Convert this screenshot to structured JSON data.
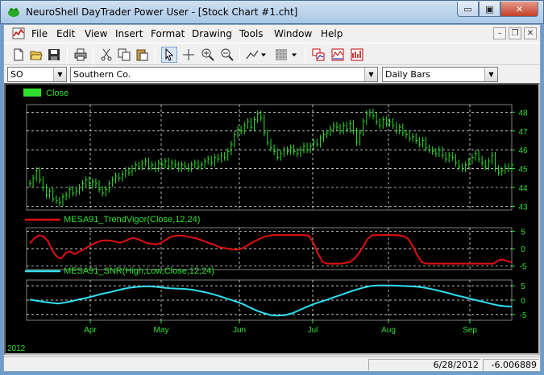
{
  "window": {
    "title": "NeuroShell DayTrader Power User - [Stock Chart #1.cht]",
    "min_glyph": "▭",
    "max_glyph": "▣",
    "close_glyph": "✕"
  },
  "menu": {
    "items": [
      "File",
      "Edit",
      "View",
      "Insert",
      "Format",
      "Drawing",
      "Tools",
      "Window",
      "Help"
    ],
    "mdi_min": "–",
    "mdi_restore": "❐",
    "mdi_close": "✕"
  },
  "toolbar": {
    "icons": [
      "new-document-icon",
      "open-folder-icon",
      "save-icon",
      "print-icon",
      "cut-icon",
      "copy-icon",
      "paste-icon",
      "pointer-icon",
      "crosshair-icon",
      "zoom-in-icon",
      "zoom-out-icon",
      "line-tool-icon",
      "fill-pattern-icon",
      "chart-window-icon",
      "indicator-icon",
      "bar-chart-icon"
    ]
  },
  "selectors": {
    "symbol": "SO",
    "company": "Southern Co.",
    "period": "Daily Bars"
  },
  "chart": {
    "colors": {
      "price": "#2fe02f",
      "trendvigor": "#e01010",
      "snr": "#30e0f0",
      "grid": "#ffffff",
      "axis_text": "#2fe02f",
      "background": "#000000"
    },
    "year_label": "2012"
  },
  "chart_data": [
    {
      "type": "bar",
      "legend": "Close",
      "series": [
        {
          "name": "Close",
          "values": [
            44.2,
            44.5,
            44.9,
            44.4,
            44.0,
            43.6,
            43.8,
            43.4,
            43.3,
            43.2,
            43.5,
            43.6,
            43.9,
            43.7,
            43.8,
            44.0,
            44.2,
            44.4,
            44.1,
            44.3,
            44.2,
            43.9,
            43.7,
            43.9,
            44.2,
            44.4,
            44.6,
            44.5,
            44.7,
            44.9,
            44.8,
            45.0,
            45.2,
            45.1,
            45.3,
            45.4,
            45.1,
            45.2,
            45.0,
            45.3,
            45.2,
            45.4,
            45.1,
            45.3,
            45.2,
            45.0,
            45.2,
            45.1,
            45.0,
            45.2,
            45.3,
            45.1,
            45.2,
            45.4,
            45.5,
            45.3,
            45.6,
            45.5,
            45.7,
            45.6,
            45.9,
            46.3,
            46.8,
            47.1,
            47.0,
            47.3,
            47.5,
            47.2,
            47.6,
            47.9,
            47.7,
            46.9,
            46.4,
            46.1,
            45.9,
            45.6,
            45.8,
            46.0,
            45.9,
            46.1,
            45.9,
            45.8,
            46.0,
            46.2,
            46.0,
            46.2,
            46.4,
            46.3,
            46.6,
            46.8,
            46.9,
            47.1,
            47.3,
            47.2,
            47.0,
            47.3,
            47.1,
            47.4,
            47.0,
            46.4,
            46.9,
            47.5,
            47.9,
            48.0,
            47.8,
            47.5,
            47.3,
            47.6,
            47.4,
            47.5,
            47.3,
            47.0,
            47.2,
            46.9,
            46.8,
            46.6,
            46.7,
            46.5,
            46.3,
            46.5,
            46.1,
            46.0,
            45.9,
            45.8,
            46.0,
            45.7,
            45.5,
            45.7,
            45.6,
            45.3,
            45.1,
            45.0,
            45.2,
            45.4,
            45.6,
            45.8,
            45.5,
            45.3,
            45.1,
            45.4,
            45.7,
            45.0,
            44.8,
            44.9,
            45.1,
            45.0,
            45.2
          ]
        }
      ],
      "yticks": [
        43,
        44,
        45,
        46,
        47,
        48
      ],
      "ylim": [
        42.8,
        48.4
      ]
    },
    {
      "type": "line",
      "legend": "MESA91_TrendVigor(Close,12,24)",
      "series": [
        {
          "name": "MESA91_TrendVigor(Close,12,24)",
          "values": [
            1.5,
            3.0,
            3.8,
            3.5,
            2.2,
            -0.5,
            -2.3,
            -2.8,
            -1.2,
            -0.8,
            -1.6,
            -0.8,
            -0.2,
            0.6,
            1.3,
            1.9,
            2.3,
            2.4,
            2.3,
            2.0,
            1.7,
            2.1,
            2.7,
            3.1,
            2.7,
            2.2,
            1.6,
            1.4,
            1.2,
            1.6,
            2.4,
            3.2,
            3.6,
            3.8,
            3.7,
            3.5,
            3.2,
            2.9,
            2.5,
            2.0,
            1.5,
            1.1,
            0.5,
            0.2,
            0.0,
            -0.2,
            -0.3,
            0.0,
            0.7,
            1.5,
            2.2,
            2.8,
            3.4,
            3.7,
            3.9,
            3.9,
            3.9,
            3.9,
            3.9,
            3.9,
            3.9,
            3.9,
            3.7,
            1.5,
            -1.5,
            -3.8,
            -4.3,
            -4.3,
            -4.3,
            -4.3,
            -4.1,
            -3.9,
            -2.9,
            -1.4,
            0.6,
            2.8,
            3.8,
            3.9,
            3.9,
            3.9,
            3.9,
            3.9,
            3.8,
            3.6,
            2.8,
            0.8,
            -1.8,
            -3.8,
            -4.3,
            -4.3,
            -4.3,
            -4.3,
            -4.3,
            -4.3,
            -4.3,
            -4.3,
            -4.3,
            -4.3,
            -4.3,
            -4.3,
            -4.3,
            -4.3,
            -4.3,
            -4.3,
            -3.4,
            -3.1,
            -3.6,
            -3.9
          ]
        }
      ],
      "yticks": [
        5,
        0,
        -5
      ],
      "ylim": [
        -6,
        6
      ]
    },
    {
      "type": "line",
      "legend": "MESA91_SNR(High,Low,Close,12,24)",
      "series": [
        {
          "name": "MESA91_SNR(High,Low,Close,12,24)",
          "values": [
            0.2,
            -0.2,
            -0.6,
            -0.9,
            -1.2,
            -0.8,
            -0.3,
            0.3,
            0.8,
            1.4,
            2.1,
            2.6,
            3.2,
            3.8,
            4.3,
            4.6,
            4.8,
            4.8,
            4.6,
            4.3,
            4.1,
            4.0,
            3.9,
            3.6,
            3.1,
            2.6,
            2.0,
            1.2,
            0.4,
            -0.4,
            -1.3,
            -2.5,
            -3.6,
            -4.5,
            -5.2,
            -5.4,
            -5.2,
            -4.6,
            -3.5,
            -2.4,
            -1.4,
            -0.6,
            0.2,
            1.1,
            1.9,
            2.8,
            3.6,
            4.3,
            4.9,
            5.1,
            5.1,
            5.1,
            5.0,
            4.9,
            4.8,
            4.6,
            4.2,
            3.7,
            3.1,
            2.5,
            1.8,
            1.2,
            0.6,
            0.0,
            -0.6,
            -1.2,
            -1.8,
            -2.1,
            -2.2
          ]
        }
      ],
      "yticks": [
        5,
        0,
        -5
      ],
      "ylim": [
        -7,
        7
      ]
    }
  ],
  "xaxis": {
    "months": [
      "Apr",
      "May",
      "Jun",
      "Jul",
      "Aug",
      "Sep"
    ]
  },
  "status": {
    "date": "6/28/2012",
    "value": "-6.006889"
  }
}
